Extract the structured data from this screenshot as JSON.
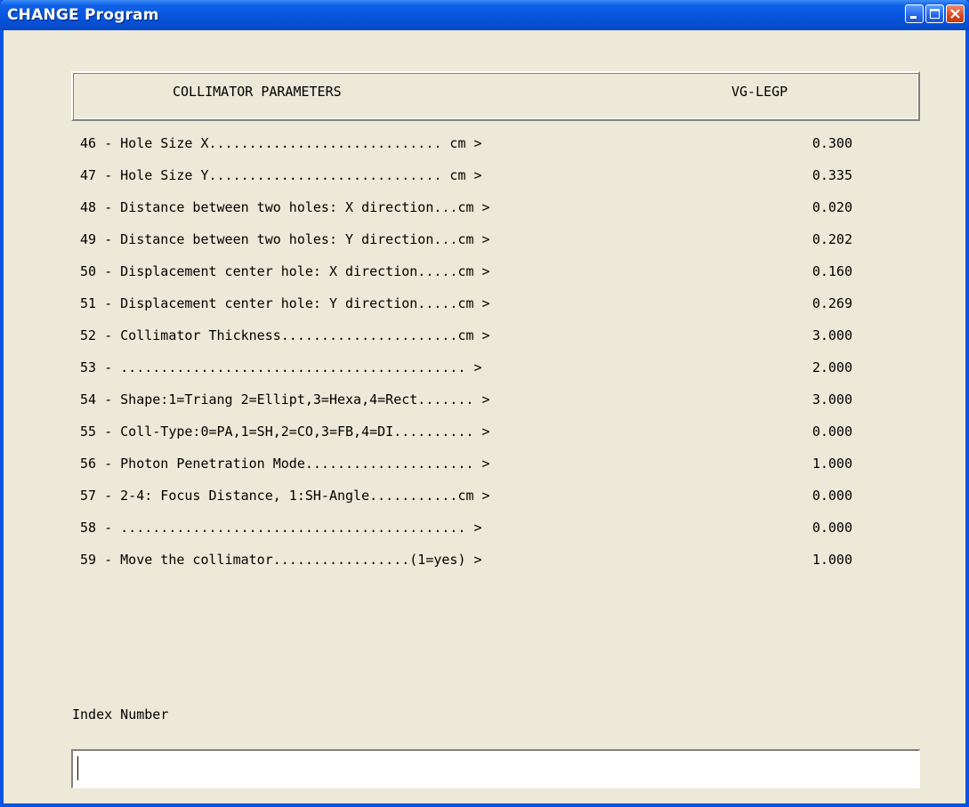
{
  "window": {
    "title": "CHANGE Program"
  },
  "header": {
    "title": "COLLIMATOR PARAMETERS",
    "column": "VG-LEGP"
  },
  "params": [
    {
      "label": "46 - Hole Size X............................. cm >",
      "value": "0.300"
    },
    {
      "label": "47 - Hole Size Y............................. cm >",
      "value": "0.335"
    },
    {
      "label": "48 - Distance between two holes: X direction...cm >",
      "value": "0.020"
    },
    {
      "label": "49 - Distance between two holes: Y direction...cm >",
      "value": "0.202"
    },
    {
      "label": "50 - Displacement center hole: X direction.....cm >",
      "value": "0.160"
    },
    {
      "label": "51 - Displacement center hole: Y direction.....cm >",
      "value": "0.269"
    },
    {
      "label": "52 - Collimator Thickness......................cm >",
      "value": "3.000"
    },
    {
      "label": "53 - ........................................... >",
      "value": "2.000"
    },
    {
      "label": "54 - Shape:1=Triang 2=Ellipt,3=Hexa,4=Rect....... >",
      "value": "3.000"
    },
    {
      "label": "55 - Coll-Type:0=PA,1=SH,2=CO,3=FB,4=DI.......... >",
      "value": "0.000"
    },
    {
      "label": "56 - Photon Penetration Mode..................... >",
      "value": "1.000"
    },
    {
      "label": "57 - 2-4: Focus Distance, 1:SH-Angle...........cm >",
      "value": "0.000"
    },
    {
      "label": "58 - ........................................... >",
      "value": "0.000"
    },
    {
      "label": "59 - Move the collimator.................(1=yes) >",
      "value": "1.000"
    }
  ],
  "index": {
    "label": "Index Number",
    "value": ""
  },
  "icons": {
    "minimize": "minimize-icon",
    "maximize": "maximize-icon",
    "close": "close-icon"
  },
  "colors": {
    "titlebar": "#0855dd",
    "window_bg": "#ece9d8",
    "close_button": "#d9471e"
  }
}
